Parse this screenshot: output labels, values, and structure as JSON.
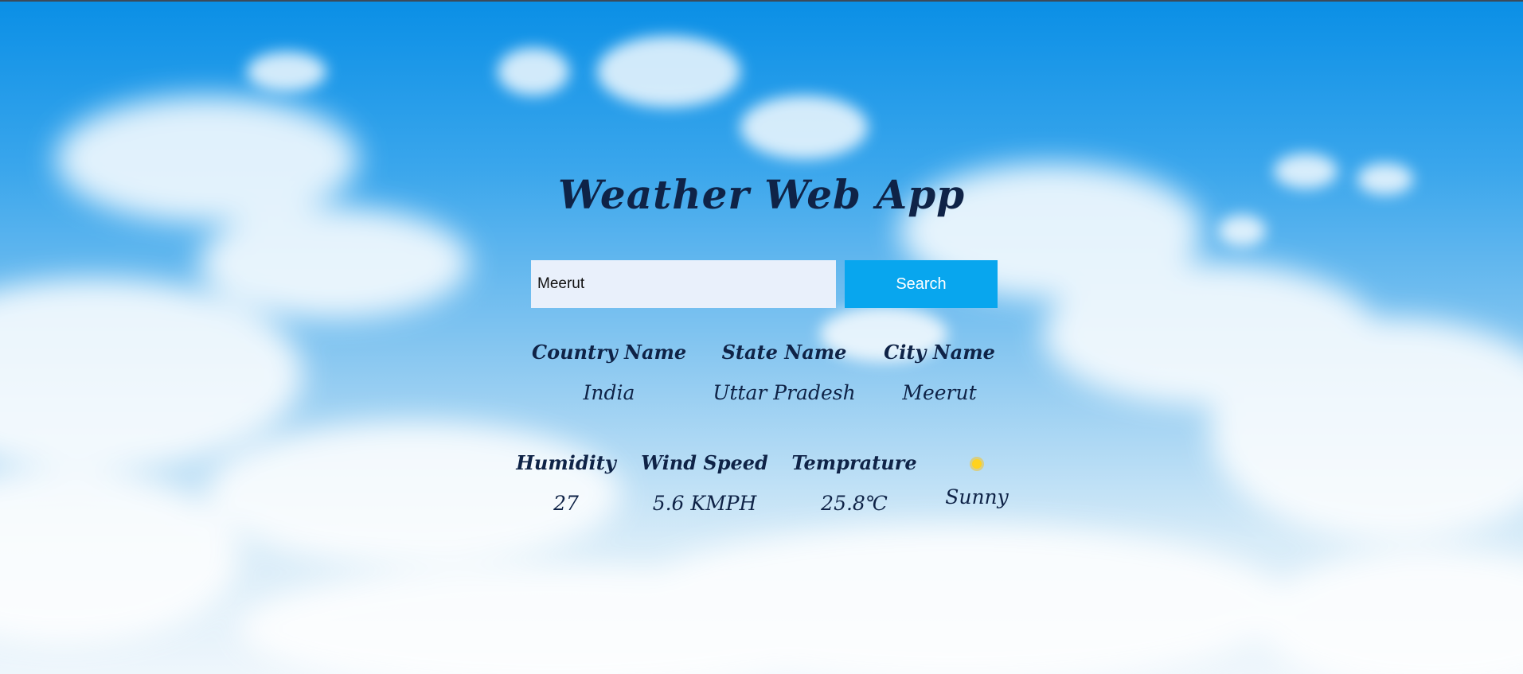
{
  "app": {
    "title": "Weather Web App"
  },
  "search": {
    "value": "Meerut",
    "button_label": "Search"
  },
  "location": {
    "country_label": "Country Name",
    "country_value": "India",
    "state_label": "State Name",
    "state_value": "Uttar Pradesh",
    "city_label": "City Name",
    "city_value": "Meerut"
  },
  "weather": {
    "humidity_label": "Humidity",
    "humidity_value": "27",
    "wind_label": "Wind Speed",
    "wind_value": "5.6 KMPH",
    "temp_label": "Temprature",
    "temp_value": "25.8℃",
    "condition_icon": "sun-icon",
    "condition_value": "Sunny"
  },
  "colors": {
    "title_text": "#0f2347",
    "button_bg": "#08a6ee",
    "input_bg": "#e9f0fb"
  }
}
